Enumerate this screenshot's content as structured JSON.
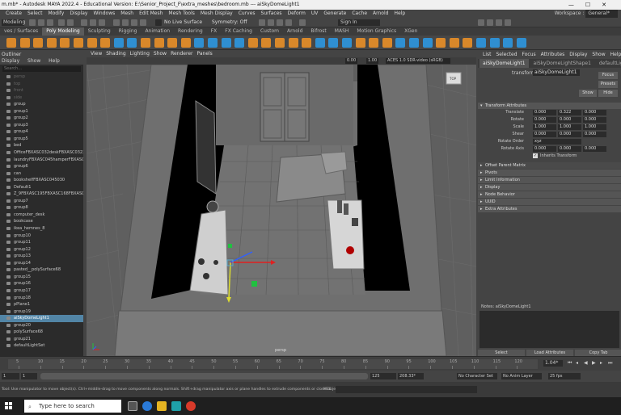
{
  "window": {
    "title": "m.mb* - Autodesk MAYA 2022.4 - Educational Version: E:\\Senior_Project_F\\extra_meshes\\bedroom.mb  ---  aiSkyDomeLight1",
    "controls": [
      "—",
      "☐",
      "✕"
    ]
  },
  "menubar": {
    "items": [
      "Create",
      "Select",
      "Modify",
      "Display",
      "Windows",
      "Mesh",
      "Edit Mesh",
      "Mesh Tools",
      "Mesh Display",
      "Curves",
      "Surfaces",
      "Deform",
      "UV",
      "Generate",
      "Cache",
      "Arnold",
      "Help"
    ],
    "workspace_label": "Workspace :",
    "workspace_value": "General*"
  },
  "statusline": {
    "mode": "Modeling",
    "no_live_surface": "No Live Surface",
    "symmetry": "Symmetry: Off",
    "sign_in": "Sign In"
  },
  "shelf": {
    "tabs": [
      "ves / Surfaces",
      "Poly Modeling",
      "Sculpting",
      "Rigging",
      "Animation",
      "Rendering",
      "FX",
      "FX Caching",
      "Custom",
      "Arnold",
      "Bifrost",
      "MASH",
      "Motion Graphics",
      "XGen"
    ],
    "active_tab": 1
  },
  "outliner": {
    "title": "Outliner",
    "menu": [
      "Display",
      "Show",
      "Help"
    ],
    "search_placeholder": "Search...",
    "items": [
      {
        "label": "persp",
        "state": "dim"
      },
      {
        "label": "top",
        "state": "dim"
      },
      {
        "label": "front",
        "state": "dim"
      },
      {
        "label": "side",
        "state": "dim"
      },
      {
        "label": "group",
        "state": ""
      },
      {
        "label": "group1",
        "state": ""
      },
      {
        "label": "group2",
        "state": ""
      },
      {
        "label": "group3",
        "state": ""
      },
      {
        "label": "group4",
        "state": ""
      },
      {
        "label": "group5",
        "state": ""
      },
      {
        "label": "bed",
        "state": ""
      },
      {
        "label": "OfficeFBXASC032deskFBXASC0322FBXASC",
        "state": ""
      },
      {
        "label": "laundryFBXASC045hamperFBXASC04",
        "state": ""
      },
      {
        "label": "group6",
        "state": ""
      },
      {
        "label": "can",
        "state": ""
      },
      {
        "label": "bookshelfFBXASC045030",
        "state": ""
      },
      {
        "label": "Default1",
        "state": ""
      },
      {
        "label": "Z_9FBXASC195FBXASC168FBXASC046L",
        "state": ""
      },
      {
        "label": "group7",
        "state": ""
      },
      {
        "label": "group8",
        "state": ""
      },
      {
        "label": "computer_desk",
        "state": ""
      },
      {
        "label": "bookcase",
        "state": ""
      },
      {
        "label": "ikea_hemnes_8",
        "state": ""
      },
      {
        "label": "group10",
        "state": ""
      },
      {
        "label": "group11",
        "state": ""
      },
      {
        "label": "group12",
        "state": ""
      },
      {
        "label": "group13",
        "state": ""
      },
      {
        "label": "group14",
        "state": ""
      },
      {
        "label": "pasted__polySurface68",
        "state": ""
      },
      {
        "label": "group15",
        "state": ""
      },
      {
        "label": "group16",
        "state": ""
      },
      {
        "label": "group17",
        "state": ""
      },
      {
        "label": "group18",
        "state": ""
      },
      {
        "label": "pPlane1",
        "state": ""
      },
      {
        "label": "group19",
        "state": ""
      },
      {
        "label": "aiSkyDomeLight1",
        "state": "sel"
      },
      {
        "label": "group20",
        "state": ""
      },
      {
        "label": "polySurface68",
        "state": ""
      },
      {
        "label": "group21",
        "state": ""
      },
      {
        "label": "defaultLightSet",
        "state": ""
      }
    ]
  },
  "viewport": {
    "menu": [
      "View",
      "Shading",
      "Lighting",
      "Show",
      "Renderer",
      "Panels"
    ],
    "near_value": "0.00",
    "far_value": "1.00",
    "colorspace": "ACES 1.0 SDR-video (sRGB)",
    "camera_label": "persp",
    "viewcube_label": "TOP"
  },
  "attribute_editor": {
    "menu": [
      "List",
      "Selected",
      "Focus",
      "Attributes",
      "Display",
      "Show",
      "Help"
    ],
    "tabs": [
      "aiSkyDomeLight1",
      "aiSkyDomeLightShape1",
      "defaultLightSe"
    ],
    "transform_label": "transform:",
    "transform_value": "aiSkyDomeLight1",
    "buttons": {
      "focus": "Focus",
      "presets": "Presets",
      "show": "Show",
      "hide": "Hide"
    },
    "section_transform": "Transform Attributes",
    "attributes": [
      {
        "label": "Translate",
        "values": [
          "0.000",
          "0.322",
          "0.000"
        ]
      },
      {
        "label": "Rotate",
        "values": [
          "0.000",
          "0.000",
          "0.000"
        ]
      },
      {
        "label": "Scale",
        "values": [
          "1.000",
          "1.000",
          "1.000"
        ]
      },
      {
        "label": "Shear",
        "values": [
          "0.000",
          "0.000",
          "0.000"
        ]
      },
      {
        "label": "Rotate Order",
        "values": [
          "xyz"
        ]
      },
      {
        "label": "Rotate Axis",
        "values": [
          "0.000",
          "0.000",
          "0.000"
        ]
      }
    ],
    "inherits_transform": "Inherits Transform",
    "collapsed_sections": [
      "Offset Parent Matrix",
      "Pivots",
      "Limit Information",
      "Display",
      "Node Behavior",
      "UUID",
      "Extra Attributes"
    ],
    "notes_label": "Notes:  aiSkyDomeLight1",
    "bottom_buttons": [
      "Select",
      "Load Attributes",
      "Copy Tab"
    ]
  },
  "timeline": {
    "ticks": [
      "5",
      "10",
      "15",
      "20",
      "25",
      "30",
      "35",
      "40",
      "45",
      "50",
      "55",
      "60",
      "65",
      "70",
      "75",
      "80",
      "85",
      "90",
      "95",
      "100",
      "105",
      "110",
      "115",
      "120"
    ],
    "current_frame": "1.04*",
    "range_start": "1",
    "range_inner_start": "1",
    "range_end_inner": "125",
    "range_end": "125",
    "range_max": "208.33*",
    "character_set": "No Character Set",
    "anim_layer": "No Anim Layer",
    "fps": "25 fps"
  },
  "helpline": {
    "text": "Tool: Use manipulator to move object(s). Ctrl+middle-drag to move components along normals. Shift+drag manipulator axis or plane handles to extrude components or clone objects. Ctrl+Shift+drag to constrain",
    "mel_label": "MEL"
  },
  "taskbar": {
    "search_placeholder": "Type here to search"
  },
  "colors": {
    "selection": "#5285a6",
    "active_shelf": "#5b5b5b",
    "viewport_bg": "#5f5f5f",
    "manip_x": "#e02020",
    "manip_y": "#20c040",
    "manip_z": "#3060ff"
  }
}
